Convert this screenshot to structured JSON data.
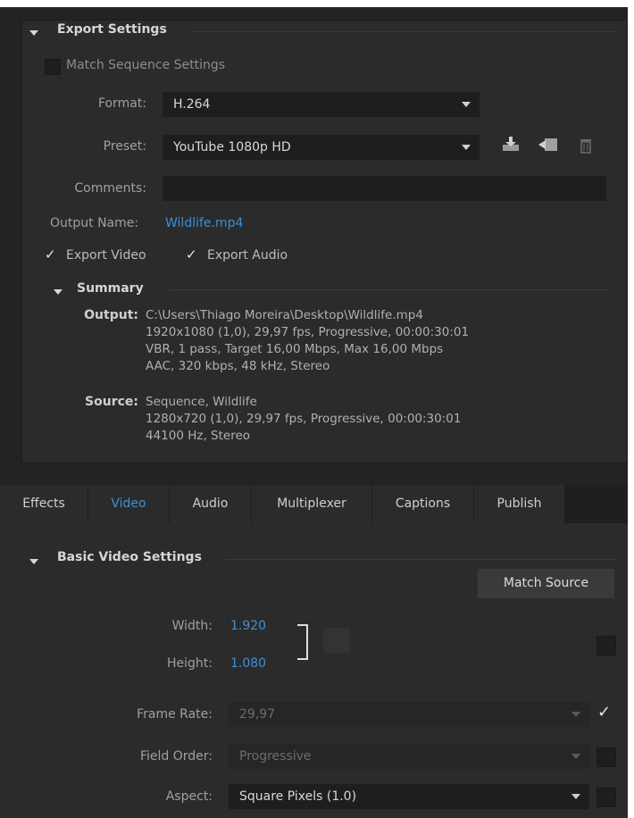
{
  "export_settings": {
    "header": "Export Settings",
    "match_sequence_label": "Match Sequence Settings",
    "format_label": "Format:",
    "format_value": "H.264",
    "preset_label": "Preset:",
    "preset_value": "YouTube 1080p HD",
    "comments_label": "Comments:",
    "comments_value": "",
    "output_name_label": "Output Name:",
    "output_name_value": "Wildlife.mp4",
    "export_video_label": "Export Video",
    "export_audio_label": "Export Audio",
    "export_video_checked": true,
    "export_audio_checked": true,
    "icons": [
      "save-preset-icon",
      "import-preset-icon",
      "delete-preset-icon"
    ]
  },
  "summary": {
    "header": "Summary",
    "output_key": "Output:",
    "output_lines": [
      "C:\\Users\\Thiago Moreira\\Desktop\\Wildlife.mp4",
      "1920x1080 (1,0), 29,97 fps, Progressive, 00:00:30:01",
      "VBR, 1 pass, Target 16,00 Mbps, Max 16,00 Mbps",
      "AAC, 320 kbps, 48 kHz, Stereo"
    ],
    "source_key": "Source:",
    "source_lines": [
      "Sequence, Wildlife",
      "1280x720 (1,0), 29,97 fps, Progressive, 00:00:30:01",
      "44100 Hz, Stereo"
    ]
  },
  "tabs": [
    {
      "label": "Effects",
      "active": false
    },
    {
      "label": "Video",
      "active": true
    },
    {
      "label": "Audio",
      "active": false
    },
    {
      "label": "Multiplexer",
      "active": false
    },
    {
      "label": "Captions",
      "active": false
    },
    {
      "label": "Publish",
      "active": false
    }
  ],
  "video": {
    "header": "Basic Video Settings",
    "match_source_label": "Match Source",
    "width_label": "Width:",
    "width_value": "1.920",
    "height_label": "Height:",
    "height_value": "1.080",
    "frame_rate_label": "Frame Rate:",
    "frame_rate_value": "29,97",
    "frame_rate_checked": true,
    "field_order_label": "Field Order:",
    "field_order_value": "Progressive",
    "field_order_checked": false,
    "aspect_label": "Aspect:",
    "aspect_value": "Square Pixels (1.0)",
    "aspect_checked": false,
    "checkmark_glyph": "✓"
  },
  "colors": {
    "accent_blue": "#3c8fd6",
    "panel_bg": "#2b2b2b",
    "field_bg": "#1e1e1e"
  }
}
